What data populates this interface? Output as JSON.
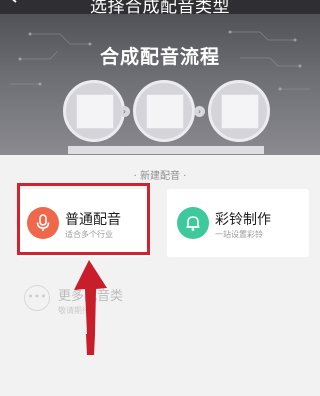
{
  "header": {
    "title": "选择合成配音类型",
    "back_icon": "chevron-left-icon"
  },
  "banner": {
    "title": "合成配音流程",
    "steps_count": 3
  },
  "section": {
    "title": "· 新建配音 ·"
  },
  "cards": [
    {
      "title": "普通配音",
      "subtitle": "适合多个行业",
      "icon": "microphone-icon",
      "icon_color": "#f0684c"
    },
    {
      "title": "彩铃制作",
      "subtitle": "一站设置彩铃",
      "icon": "bell-icon",
      "icon_color": "#3ec99c"
    }
  ],
  "more": {
    "title": "更多配音类",
    "subtitle": "敬请期待",
    "icon": "ellipsis-icon"
  },
  "colors": {
    "header_bg": "#2f2f33",
    "highlight": "#d1232f",
    "arrow": "#d1232f"
  }
}
